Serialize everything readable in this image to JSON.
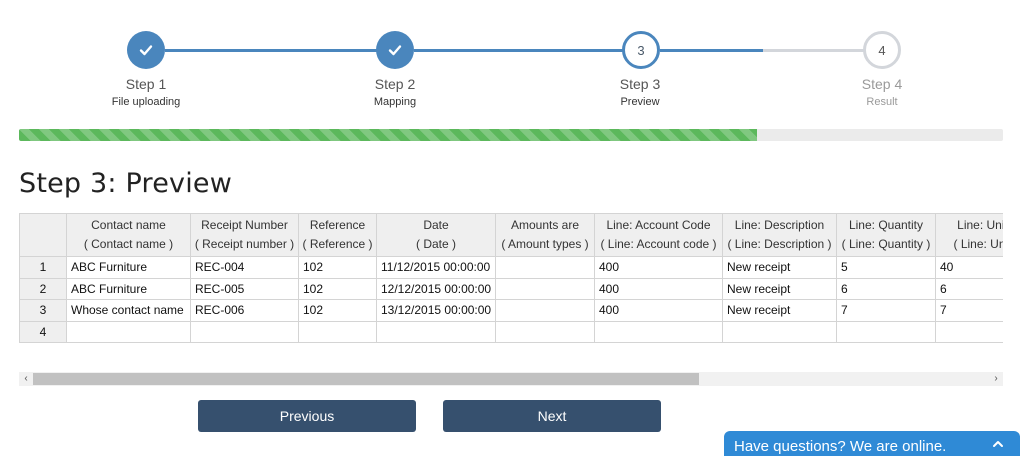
{
  "stepper": {
    "steps": [
      {
        "title": "Step 1",
        "subtitle": "File uploading",
        "status": "done"
      },
      {
        "title": "Step 2",
        "subtitle": "Mapping",
        "status": "done"
      },
      {
        "title": "Step 3",
        "subtitle": "Preview",
        "status": "active",
        "number": "3"
      },
      {
        "title": "Step 4",
        "subtitle": "Result",
        "status": "pending",
        "number": "4"
      }
    ],
    "progress": 0.75,
    "colors": {
      "done": "#4a86bd",
      "pending": "#d3d6db",
      "progress": "#5cb85c"
    }
  },
  "page_title": "Step 3: Preview",
  "table": {
    "columns": [
      {
        "name": "Contact name",
        "source": "( Contact name )"
      },
      {
        "name": "Receipt Number",
        "source": "( Receipt number )"
      },
      {
        "name": "Reference",
        "source": "( Reference )"
      },
      {
        "name": "Date",
        "source": "( Date )"
      },
      {
        "name": "Amounts are",
        "source": "( Amount types )"
      },
      {
        "name": "Line: Account Code",
        "source": "( Line: Account code )"
      },
      {
        "name": "Line: Description",
        "source": "( Line: Description )"
      },
      {
        "name": "Line: Quantity",
        "source": "( Line: Quantity )"
      },
      {
        "name": "Line: Unit",
        "source": "( Line: Unit"
      }
    ],
    "rows": [
      {
        "num": "1",
        "cells": [
          "ABC Furniture",
          "REC-004",
          "102",
          "11/12/2015 00:00:00",
          "",
          "400",
          "New receipt",
          "5",
          "40"
        ]
      },
      {
        "num": "2",
        "cells": [
          "ABC Furniture",
          "REC-005",
          "102",
          "12/12/2015 00:00:00",
          "",
          "400",
          "New receipt",
          "6",
          "6"
        ]
      },
      {
        "num": "3",
        "cells": [
          "Whose contact name",
          "REC-006",
          "102",
          "13/12/2015 00:00:00",
          "",
          "400",
          "New receipt",
          "7",
          "7"
        ]
      },
      {
        "num": "4",
        "cells": [
          "",
          "",
          "",
          "",
          "",
          "",
          "",
          "",
          ""
        ]
      }
    ]
  },
  "scrollbar": {
    "left_arrow": "‹",
    "right_arrow": "›"
  },
  "buttons": {
    "previous": "Previous",
    "next": "Next"
  },
  "chat": {
    "label": "Have questions? We are online.",
    "icon": "chevron-up-icon"
  }
}
